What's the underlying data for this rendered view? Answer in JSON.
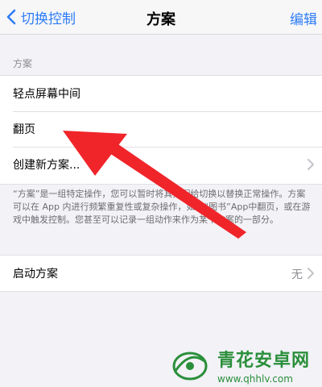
{
  "nav": {
    "back_label": "切换控制",
    "title": "方案",
    "edit_label": "编辑"
  },
  "section_header": "方案",
  "recipes": [
    {
      "label": "轻点屏幕中间"
    },
    {
      "label": "翻页"
    },
    {
      "label": "创建新方案..."
    }
  ],
  "footer": "“方案”是一组特定操作，您可以暂时将其分配给切换以替换正常操作。方案可以在 App 内进行频繁重复性或复杂操作，如在“图书”App中翻页，或在游戏中触发控制。您甚至可以记录一组动作来作为某个方案的一部分。",
  "launch": {
    "label": "启动方案",
    "value": "无"
  },
  "watermark": {
    "title": "青花安卓网",
    "url": "www.qhhlv.com"
  },
  "colors": {
    "accent": "#2d7cf6",
    "arrow": "#f0252a",
    "watermark": "#2a8f3a"
  }
}
